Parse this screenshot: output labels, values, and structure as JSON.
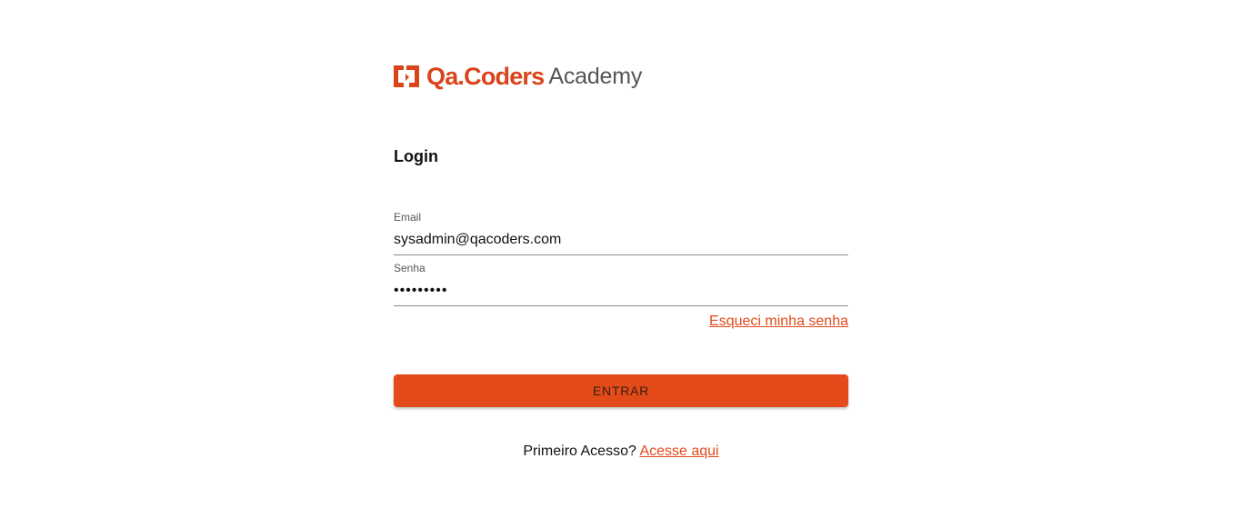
{
  "brand": {
    "name": "Qa.Coders",
    "suffix": "Academy",
    "color": "#d9441a"
  },
  "login": {
    "title": "Login",
    "email_label": "Email",
    "email_value": "sysadmin@qacoders.com",
    "password_label": "Senha",
    "password_value": "•••••••••",
    "forgot_link": "Esqueci minha senha",
    "submit_label": "ENTRAR",
    "first_access_text": "Primeiro Acesso?",
    "first_access_link": "Acesse aqui"
  },
  "colors": {
    "accent": "#e44b1a",
    "link": "#e24a1c"
  }
}
